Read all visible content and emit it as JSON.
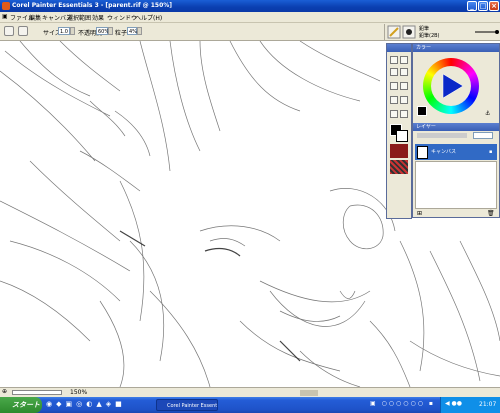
{
  "window": {
    "title": "Corel Painter Essentials 3 - [parent.rif @ 150%]"
  },
  "menubar": {
    "items": [
      "ファイル",
      "編集",
      "キャンバス",
      "選択範囲",
      "効果",
      "ウィンドウ",
      "ヘルプ(H)"
    ]
  },
  "propbar": {
    "size_label": "サイズ",
    "size_value": "1.0",
    "opacity_label": "不透明度",
    "opacity_value": "60%",
    "grain_label": "粒子",
    "grain_value": "4%"
  },
  "brush_selector": {
    "category": "鉛筆",
    "variant": "鉛筆(2B)"
  },
  "panels": {
    "color_title": "カラー",
    "layers_title": "レイヤー",
    "layer_name": "キャンバス",
    "opacity_field": ""
  },
  "statusbar": {
    "zoom": "150%"
  },
  "taskbar": {
    "start_label": "スタート",
    "task_label": "Corel Painter Essenti...",
    "clock": "21:07"
  },
  "colors": {
    "titlebar": "#0a3fb0",
    "taskbar": "#245dd7",
    "start_button": "#2d8a2d",
    "panel_bg": "#ece9d8",
    "selected_layer": "#316ac5"
  },
  "icons": [
    "app-icon",
    "brush-icon",
    "pencil-icon",
    "eraser-icon",
    "dropper-icon",
    "bucket-icon",
    "magnifier-icon",
    "hand-icon",
    "lasso-icon",
    "crop-icon",
    "color-wheel",
    "trash-icon",
    "eye-icon",
    "lock-icon"
  ]
}
